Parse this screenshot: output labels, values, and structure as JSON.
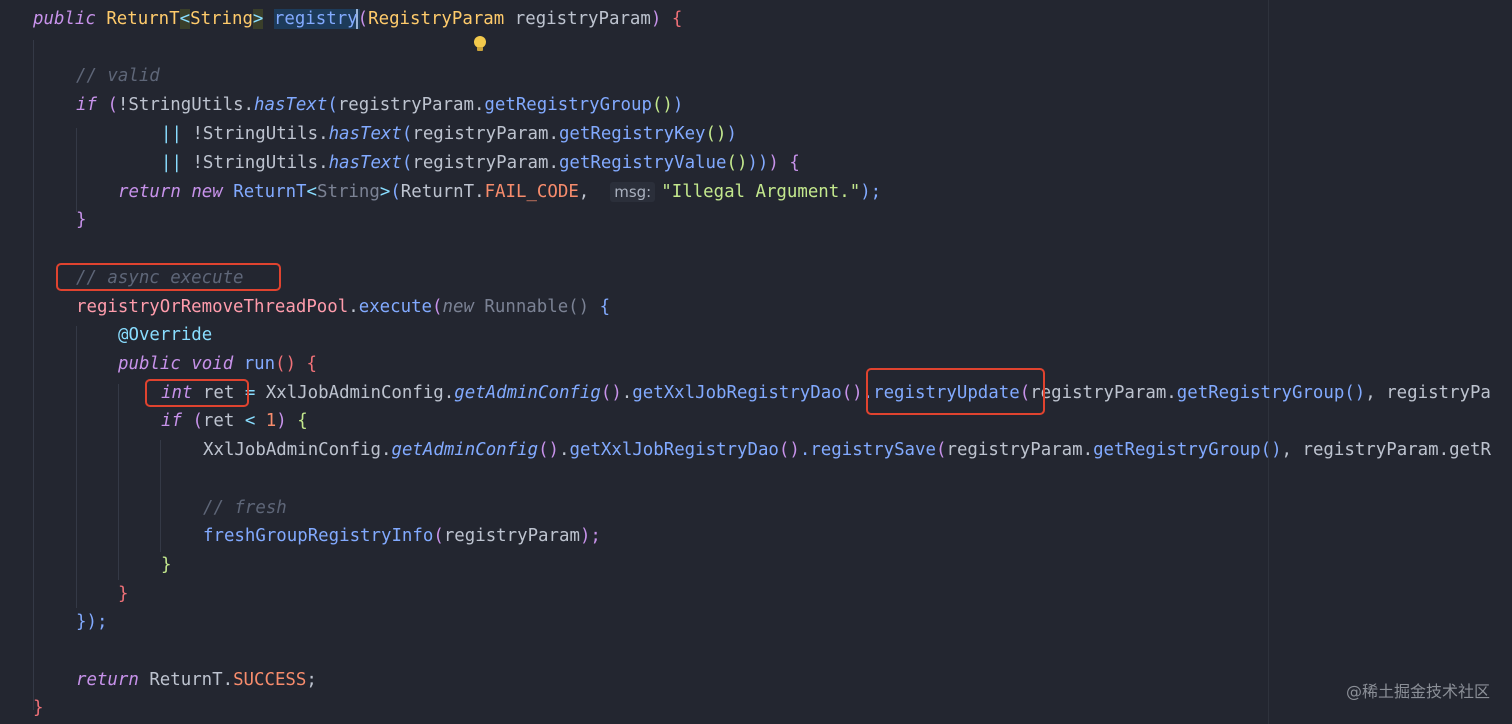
{
  "code": {
    "signature": {
      "public": "public",
      "return_type": "ReturnT",
      "generic_open": "<",
      "generic_type": "String",
      "generic_close": ">",
      "method_name": "registry",
      "param_open": "(",
      "param_type": "RegistryParam",
      "param_name": "registryParam",
      "param_close": ")",
      "brace": "{"
    },
    "comment_valid": "// valid",
    "if_line": {
      "kw": "if",
      "open": "(",
      "bang_class": "!StringUtils.",
      "method": "hasText",
      "arg_open": "(",
      "arg": "registryParam.",
      "getter": "getRegistryGroup",
      "getter_call": "()",
      "close": ")"
    },
    "or_line_1": {
      "op": "||",
      "bang_class": "!StringUtils.",
      "method": "hasText",
      "arg_open": "(",
      "arg": "registryParam.",
      "getter": "getRegistryKey",
      "getter_call": "()",
      "close": ")"
    },
    "or_line_2": {
      "op": "||",
      "bang_class": "!StringUtils.",
      "method": "hasText",
      "arg_open": "(",
      "arg": "registryParam.",
      "getter": "getRegistryValue",
      "getter_call": "()",
      "close": "))",
      "paren": ")",
      "brace": "{"
    },
    "return_fail": {
      "kw_return": "return",
      "kw_new": "new",
      "type": "ReturnT",
      "generic_open": "<",
      "generic_type": "String",
      "generic_close": ">",
      "open": "(",
      "owner": "ReturnT.",
      "constant": "FAIL_CODE",
      "comma": ",",
      "hint": "msg:",
      "message": "\"Illegal Argument.\"",
      "close": ");"
    },
    "close_if": "}",
    "comment_async": "// async execute",
    "execute_line": {
      "pool": "registryOrRemoveThreadPool",
      "dot": ".",
      "method": "execute",
      "open": "(",
      "kw_new": "new",
      "type": "Runnable",
      "call": "()",
      "brace": "{"
    },
    "override": "@Override",
    "run_line": {
      "kw_public": "public",
      "kw_void": "void",
      "method": "run",
      "call": "()",
      "brace": "{"
    },
    "ret_line": {
      "kw_int": "int",
      "var": "ret",
      "eq": "=",
      "config": "XxlJobAdminConfig.",
      "get_config": "getAdminConfig",
      "call": "()",
      "dot": ".",
      "dao": "getXxlJobRegistryDao",
      "dao_call": "()",
      "update": ".registryUpdate",
      "open": "(",
      "arg": "registryParam.",
      "getter": "getRegistryGroup",
      "getter_call": "()",
      "rest": ", registryPa"
    },
    "if_ret_line": {
      "kw": "if",
      "open": "(",
      "var": "ret",
      "op": "<",
      "num": "1",
      "close": ")",
      "brace": "{"
    },
    "save_line": {
      "config": "XxlJobAdminConfig.",
      "get_config": "getAdminConfig",
      "call": "()",
      "dot": ".",
      "dao": "getXxlJobRegistryDao",
      "dao_call": "()",
      "save": ".registrySave",
      "open": "(",
      "arg": "registryParam.",
      "getter": "getRegistryGroup",
      "getter_call": "()",
      "rest": ", registryParam.getR"
    },
    "comment_fresh": "// fresh",
    "fresh_line": {
      "method": "freshGroupRegistryInfo",
      "open": "(",
      "arg": "registryParam",
      "close": ");"
    },
    "close_if_ret": "}",
    "close_run": "}",
    "close_execute": "});",
    "return_success": {
      "kw_return": "return",
      "owner": "ReturnT.",
      "constant": "SUCCESS",
      "semi": ";"
    },
    "close_method": "}"
  },
  "watermark": "@稀土掘金技术社区",
  "colors": {
    "background": "#232630",
    "highlight_box": "#e0432f",
    "keyword": "#c792ea",
    "type": "#ffcb6b",
    "function": "#82aaff",
    "string": "#c3e88d",
    "comment": "#5e6678"
  },
  "icons": {
    "intention_bulb": "lightbulb-icon"
  }
}
